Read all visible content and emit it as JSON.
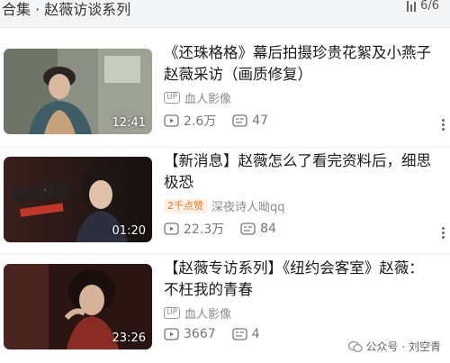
{
  "header": {
    "title": "合集 · 赵薇访谈系列",
    "count": "6/6"
  },
  "videos": [
    {
      "title": "《还珠格格》幕后拍摄珍贵花絮及小燕子赵薇采访（画质修复）",
      "author": "血人影像",
      "badge": "",
      "views": "2.6万",
      "danmaku": "47",
      "duration": "12:41"
    },
    {
      "title": "【新消息】赵薇怎么了看完资料后，细思极恐",
      "author": "深夜诗人呦qq",
      "badge": "2千点赞",
      "views": "22.3万",
      "danmaku": "84",
      "duration": "01:20",
      "overlay_text": "细思极恐"
    },
    {
      "title": "【赵薇专访系列】《纽约会客室》赵薇：不枉我的青春",
      "author": "血人影像",
      "badge": "",
      "views": "3667",
      "danmaku": "4",
      "duration": "23:26"
    }
  ],
  "watermark": "公众号 · 刘空青",
  "colors": {
    "header_bg": "#f4f5f7",
    "badge_orange": "#f07a2a",
    "meta_gray": "#8a8a8a"
  }
}
